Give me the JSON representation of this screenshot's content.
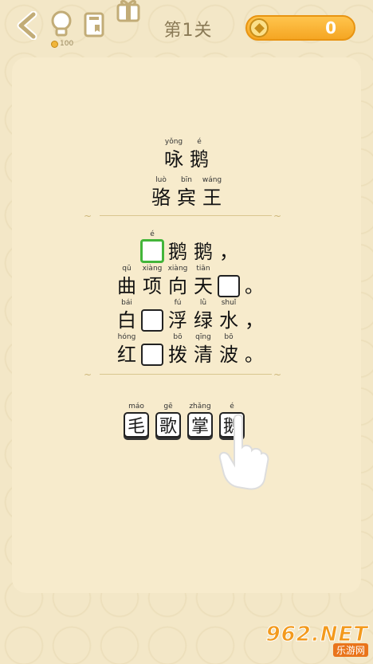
{
  "header": {
    "level_title": "第1关",
    "hint_cost": "100",
    "coins": "0"
  },
  "poem": {
    "title": {
      "chars": [
        "咏",
        "鹅"
      ],
      "pinyin": [
        "yǒng",
        "é"
      ]
    },
    "author": {
      "chars": [
        "骆",
        "宾",
        "王"
      ],
      "pinyin": [
        "luò",
        "bīn",
        "wáng"
      ]
    },
    "lines": [
      {
        "cells": [
          {
            "char": "",
            "pinyin": "é",
            "blank": true,
            "active": true
          },
          {
            "char": "鹅",
            "pinyin": ""
          },
          {
            "char": "鹅",
            "pinyin": ""
          },
          {
            "char": "，",
            "pinyin": ""
          }
        ]
      },
      {
        "cells": [
          {
            "char": "曲",
            "pinyin": "qū"
          },
          {
            "char": "项",
            "pinyin": "xiàng"
          },
          {
            "char": "向",
            "pinyin": "xiàng"
          },
          {
            "char": "天",
            "pinyin": "tiān"
          },
          {
            "char": "",
            "pinyin": "",
            "blank": true
          },
          {
            "char": "。",
            "pinyin": ""
          }
        ]
      },
      {
        "cells": [
          {
            "char": "白",
            "pinyin": "bái"
          },
          {
            "char": "",
            "pinyin": "",
            "blank": true
          },
          {
            "char": "浮",
            "pinyin": "fú"
          },
          {
            "char": "绿",
            "pinyin": "lǜ"
          },
          {
            "char": "水",
            "pinyin": "shuǐ"
          },
          {
            "char": "，",
            "pinyin": ""
          }
        ]
      },
      {
        "cells": [
          {
            "char": "红",
            "pinyin": "hóng"
          },
          {
            "char": "",
            "pinyin": "",
            "blank": true
          },
          {
            "char": "拨",
            "pinyin": "bō"
          },
          {
            "char": "清",
            "pinyin": "qīng"
          },
          {
            "char": "波",
            "pinyin": "bō"
          },
          {
            "char": "。",
            "pinyin": ""
          }
        ]
      }
    ]
  },
  "options": [
    {
      "char": "毛",
      "pinyin": "máo"
    },
    {
      "char": "歌",
      "pinyin": "gē"
    },
    {
      "char": "掌",
      "pinyin": "zhǎng"
    },
    {
      "char": "鹅",
      "pinyin": "é"
    }
  ],
  "icons": {
    "back": "back-arrow-icon",
    "hint": "lightbulb-icon",
    "book": "book-icon",
    "gift": "gift-icon",
    "coin": "coin-icon",
    "hand": "pointing-hand-icon"
  },
  "watermark": {
    "logo": "962.NET",
    "sub": "乐游网"
  },
  "colors": {
    "accent": "#f5a623",
    "active_blank": "#43b53a",
    "background": "#f3e7c7"
  }
}
